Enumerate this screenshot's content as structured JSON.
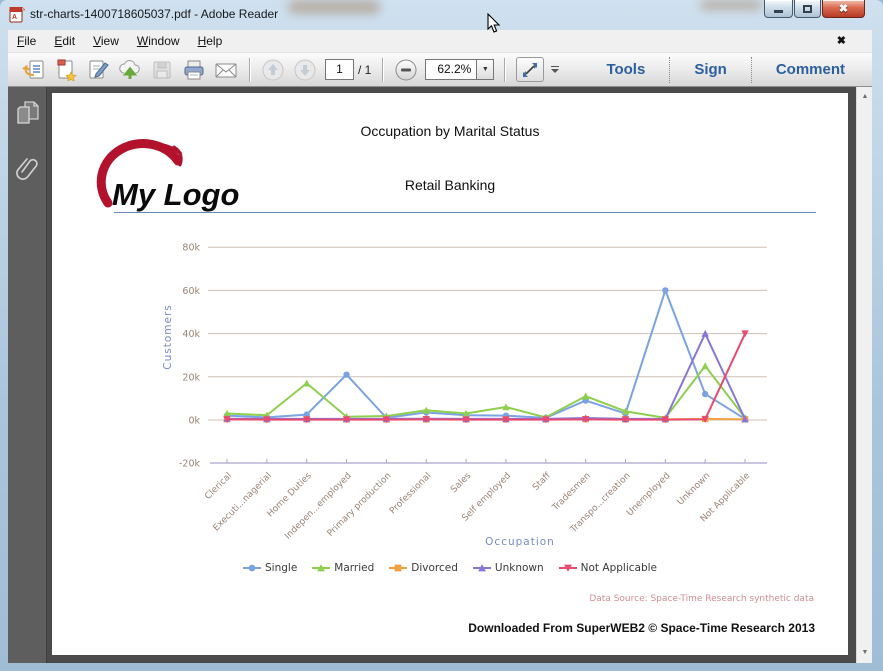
{
  "window": {
    "title": "str-charts-1400718605037.pdf - Adobe Reader"
  },
  "menu": {
    "items": [
      "File",
      "Edit",
      "View",
      "Window",
      "Help"
    ]
  },
  "toolbar": {
    "page_current": "1",
    "page_total": "/ 1",
    "zoom_level": "62.2%",
    "tools_label": "Tools",
    "sign_label": "Sign",
    "comment_label": "Comment"
  },
  "icons": {
    "menubar_close": "✖",
    "window_close": "✖",
    "zoom_dropdown": "▼",
    "scroll_up": "▲",
    "scroll_down": "▼"
  },
  "document": {
    "logo_text": "My Logo",
    "logo_swoosh_color": "#b3122d",
    "title": "Occupation by Marital Status",
    "subtitle": "Retail Banking",
    "data_source": "Data Source: Space-Time Research synthetic data",
    "footer": "Downloaded From SuperWEB2 © Space-Time Research 2013"
  },
  "chart_data": {
    "type": "line",
    "title": "Occupation by Marital Status",
    "xlabel": "Occupation",
    "ylabel": "Customers",
    "ylim": [
      -20000,
      80000
    ],
    "grid": true,
    "legend_position": "bottom",
    "grid_color": "#cfc0b5",
    "axis_line_color": "#a9a3d0",
    "tick_color": "#9c8376",
    "axis_label_color": "#7a8cc4",
    "yticks": [
      {
        "label": "80k",
        "value": 80000
      },
      {
        "label": "60k",
        "value": 60000
      },
      {
        "label": "40k",
        "value": 40000
      },
      {
        "label": "20k",
        "value": 20000
      },
      {
        "label": "0k",
        "value": 0
      },
      {
        "label": "-20k",
        "value": -20000
      }
    ],
    "categories": [
      "Clerical",
      "Executi...nagerial",
      "Home Duties",
      "Indepen...employed",
      "Primary production",
      "Professional",
      "Sales",
      "Self employed",
      "Staff",
      "Tradesmen",
      "Transpo...creation",
      "Unemployed",
      "Unknown",
      "Not Applicable"
    ],
    "series": [
      {
        "name": "Single",
        "color": "#7ba3e3",
        "marker": "circle",
        "values": [
          2000,
          1200,
          2500,
          21000,
          1000,
          3500,
          2200,
          2000,
          1000,
          9000,
          3000,
          60000,
          12000,
          500
        ]
      },
      {
        "name": "Married",
        "color": "#8ecf4d",
        "marker": "triangle",
        "values": [
          3000,
          2200,
          17000,
          1500,
          1800,
          4500,
          3000,
          6000,
          1200,
          11000,
          4000,
          1000,
          25000,
          1000
        ]
      },
      {
        "name": "Divorced",
        "color": "#f2a241",
        "marker": "square",
        "values": [
          400,
          300,
          300,
          300,
          300,
          300,
          300,
          300,
          300,
          400,
          300,
          300,
          500,
          300
        ]
      },
      {
        "name": "Unknown",
        "color": "#8a75db",
        "marker": "triangle",
        "values": [
          600,
          500,
          500,
          500,
          500,
          600,
          500,
          500,
          500,
          900,
          500,
          500,
          40000,
          400
        ]
      },
      {
        "name": "Not Applicable",
        "color": "#e84a6f",
        "marker": "triangle-down",
        "values": [
          300,
          200,
          200,
          200,
          200,
          300,
          200,
          200,
          200,
          300,
          200,
          200,
          300,
          40000
        ]
      }
    ]
  }
}
